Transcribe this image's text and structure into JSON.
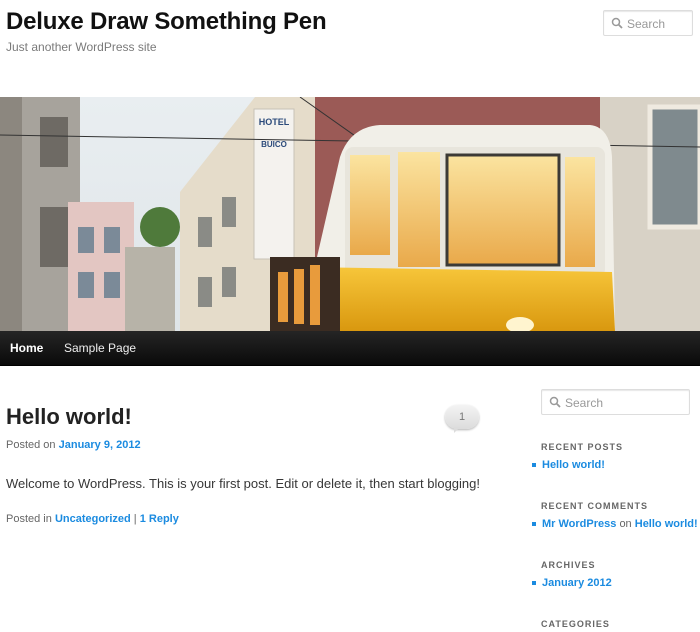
{
  "site": {
    "title": "Deluxe Draw Something Pen",
    "tagline": "Just another WordPress site"
  },
  "header_search": {
    "placeholder": "Search",
    "icon": "search-icon"
  },
  "nav": {
    "items": [
      {
        "label": "Home"
      },
      {
        "label": "Sample Page"
      }
    ]
  },
  "post": {
    "title": "Hello world!",
    "comment_count": "1",
    "posted_on_prefix": "Posted on",
    "date": "January 9, 2012",
    "content": "Welcome to WordPress. This is your first post. Edit or delete it, then start blogging!",
    "posted_in_prefix": "Posted in",
    "category": "Uncategorized",
    "separator": "|",
    "reply_link": "1 Reply"
  },
  "sidebar": {
    "search_placeholder": "Search",
    "recent_posts": {
      "title": "RECENT POSTS",
      "items": [
        "Hello world!"
      ]
    },
    "recent_comments": {
      "title": "RECENT COMMENTS",
      "author": "Mr WordPress",
      "on": "on",
      "post": "Hello world!"
    },
    "archives": {
      "title": "ARCHIVES",
      "items": [
        "January 2012"
      ]
    },
    "categories": {
      "title": "CATEGORIES"
    }
  },
  "banner": {
    "sign_text": "HOTEL BUICO ATLANTICO"
  },
  "colors": {
    "link": "#1b8be0",
    "nav_bg": "#111111",
    "tram_yellow": "#f2b51b"
  }
}
